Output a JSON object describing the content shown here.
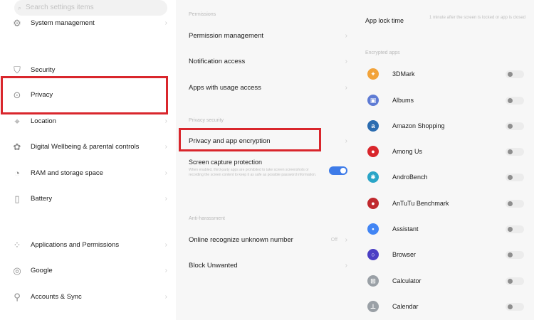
{
  "left": {
    "search_placeholder": "Search settings items",
    "items": [
      {
        "label": "System management",
        "icon": "gear-icon"
      },
      {
        "label": "Security",
        "icon": "shield-icon"
      },
      {
        "label": "Privacy",
        "icon": "privacy-icon"
      },
      {
        "label": "Location",
        "icon": "location-pin-icon"
      },
      {
        "label": "Digital Wellbeing & parental controls",
        "icon": "wellbeing-icon"
      },
      {
        "label": "RAM and storage space",
        "icon": "storage-icon"
      },
      {
        "label": "Battery",
        "icon": "battery-icon"
      },
      {
        "label": "Applications and Permissions",
        "icon": "apps-grid-icon"
      },
      {
        "label": "Google",
        "icon": "google-icon"
      },
      {
        "label": "Accounts & Sync",
        "icon": "account-icon"
      }
    ]
  },
  "middle": {
    "section_permissions": "Permissions",
    "permission_management": "Permission management",
    "notification_access": "Notification access",
    "usage_access": "Apps with usage access",
    "section_privacy_security": "Privacy security",
    "privacy_encryption": "Privacy and app encryption",
    "screen_capture_title": "Screen capture protection",
    "screen_capture_desc": "When enabled, third-party apps are prohibited to take screen screenshots or recording the screen content to keep it as safe as possible password information.",
    "section_anti_harassment": "Anti-harassment",
    "online_recognize": "Online recognize unknown number",
    "online_recognize_value": "Off",
    "block_unwanted": "Block Unwanted"
  },
  "right": {
    "app_lock_time_label": "App lock time",
    "app_lock_time_value": "1 minute after the screen is locked or app is closed",
    "section_encrypted": "Encrypted apps",
    "apps": [
      {
        "label": "3DMark",
        "color": "#f2a33a",
        "glyph": "✦"
      },
      {
        "label": "Albums",
        "color": "#5e7bd4",
        "glyph": "▣"
      },
      {
        "label": "Amazon Shopping",
        "color": "#2b6cb0",
        "glyph": "a"
      },
      {
        "label": "Among Us",
        "color": "#d9262c",
        "glyph": "●"
      },
      {
        "label": "AndroBench",
        "color": "#2aa5c7",
        "glyph": "✱"
      },
      {
        "label": "AnTuTu Benchmark",
        "color": "#c0282d",
        "glyph": "●"
      },
      {
        "label": "Assistant",
        "color": "#4285f4",
        "glyph": "•"
      },
      {
        "label": "Browser",
        "color": "#4b3fc4",
        "glyph": "○"
      },
      {
        "label": "Calculator",
        "color": "#9aa0a6",
        "glyph": "⊞"
      },
      {
        "label": "Calendar",
        "color": "#9aa0a6",
        "glyph": "⊥"
      }
    ]
  }
}
